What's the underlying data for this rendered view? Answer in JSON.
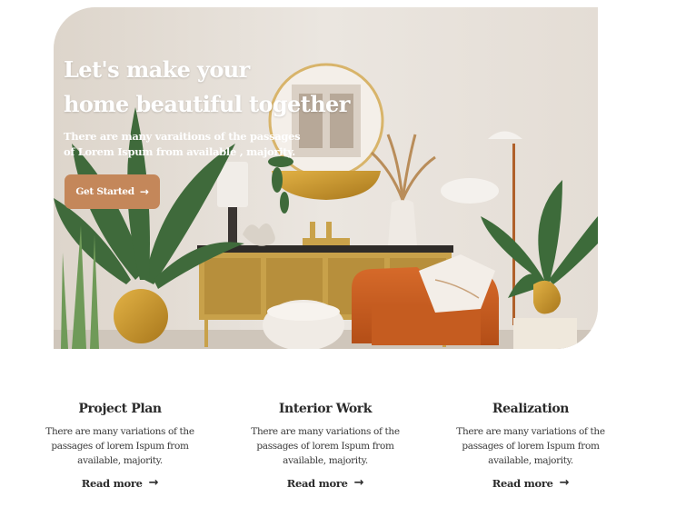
{
  "hero": {
    "title_line1": "Let's make your",
    "title_line2": "home beautiful together",
    "subtitle": "There are many varaitions of the passages of Lorem Ispum from available , majority.",
    "cta_label": "Get Started",
    "cta_icon": "arrow-right-icon"
  },
  "features": [
    {
      "title": "Project Plan",
      "text": "There are many variations of the passages of lorem Ispum from available, majority.",
      "link": "Read more",
      "link_icon": "arrow-right-icon"
    },
    {
      "title": "Interior Work",
      "text": "There are many variations of the passages of lorem Ispum from available, majority.",
      "link": "Read more",
      "link_icon": "arrow-right-icon"
    },
    {
      "title": "Realization",
      "text": "There are many variations of the passages of lorem Ispum from available, majority.",
      "link": "Read more",
      "link_icon": "arrow-right-icon"
    }
  ],
  "colors": {
    "accent": "#c4875a",
    "heading": "#2b2b2b",
    "wall": "#e9e3dc"
  }
}
